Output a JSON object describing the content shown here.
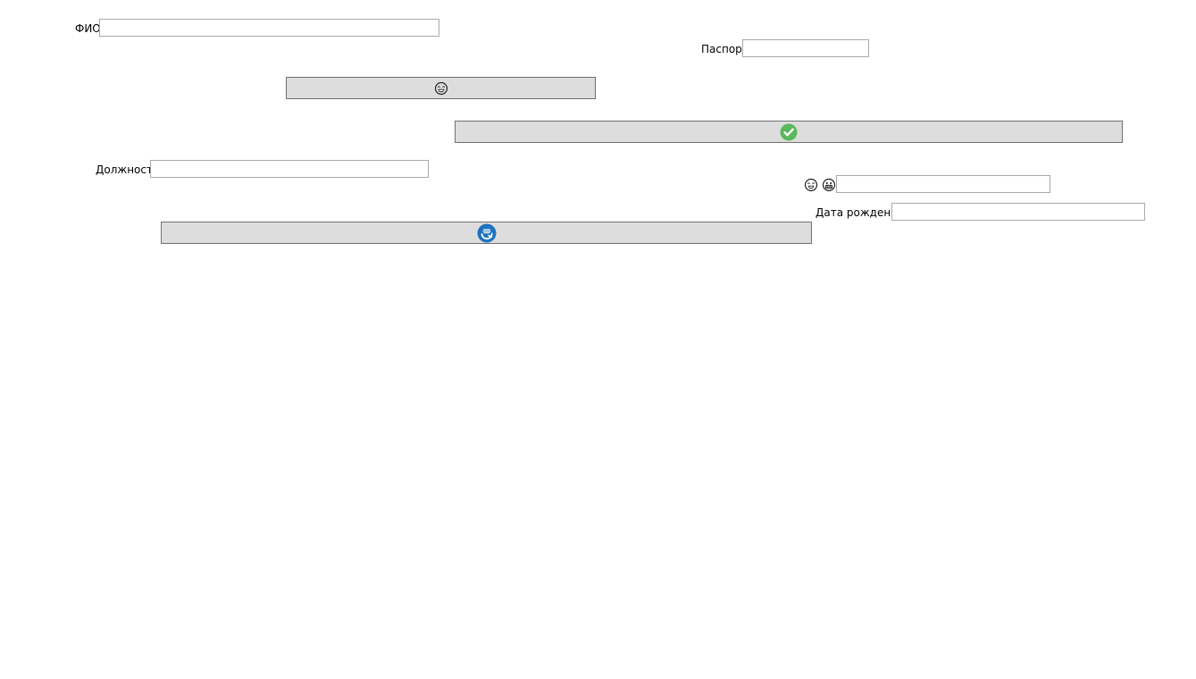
{
  "form": {
    "fio": {
      "label": "ФИО",
      "value": "",
      "placeholder": ""
    },
    "passport": {
      "label": "Паспорт",
      "value": "",
      "placeholder": ""
    },
    "position": {
      "label": "Должность",
      "value": "",
      "placeholder": ""
    },
    "birthdate": {
      "label": "Дата рождения",
      "value": "",
      "placeholder": ""
    },
    "emoji_field": {
      "value": "",
      "placeholder": ""
    }
  },
  "buttons": {
    "emoji_button": {
      "icon": "laughing-face-icon"
    },
    "confirm_button": {
      "icon": "checkmark-icon",
      "color": "#5cb85c"
    },
    "refresh_button": {
      "icon": "refresh-icon",
      "color": "#1e73be"
    }
  },
  "icons": {
    "emoji_pair": [
      "laughing-face-icon",
      "grinning-face-icon"
    ]
  }
}
